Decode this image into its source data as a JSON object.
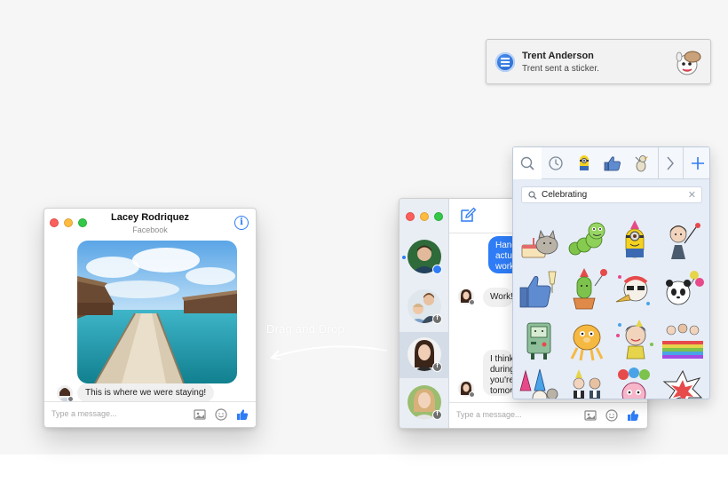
{
  "notification": {
    "title": "Trent Anderson",
    "body": "Trent sent a sticker."
  },
  "left_window": {
    "title": "Lacey Rodriquez",
    "subtitle": "Facebook",
    "message": "This is where we were staying!",
    "composer_placeholder": "Type a message..."
  },
  "drag_label": "Drag and Drop",
  "right_window": {
    "messages_out": [
      {
        "lines": [
          "Hang",
          "actu",
          "work"
        ]
      }
    ],
    "messages_in": [
      {
        "lines": [
          "Work!"
        ]
      },
      {
        "lines": [
          "I think",
          "during",
          "you're",
          "tomor"
        ]
      }
    ],
    "composer_placeholder": "Type a message..."
  },
  "sticker_panel": {
    "search_value": "Celebrating",
    "tabs": [
      "search-icon",
      "recent-icon",
      "minion-pack-icon",
      "thumbs-up-pack-icon",
      "bird-pack-icon",
      "next-icon",
      "add-icon"
    ],
    "stickers": [
      "pusheen-cake-sticker",
      "caterpillar-sticker",
      "minion-party-sticker",
      "girl-balloons-sticker",
      "thumbs-up-champagne-sticker",
      "cactus-party-sticker",
      "horn-blower-sticker",
      "panda-balloons-sticker",
      "robot-sticker",
      "jake-dog-sticker",
      "girl-confetti-sticker",
      "crowd-banner-sticker",
      "party-hats-sticker",
      "couple-party-sticker",
      "clown-balloons-sticker",
      "explosion-sticker"
    ]
  },
  "colors": {
    "accent_blue": "#2e7cf6",
    "sidebar_bg": "#e9eef4",
    "sticker_panel_bg": "#e6edf7",
    "bubble_in": "#f0f0f0"
  }
}
